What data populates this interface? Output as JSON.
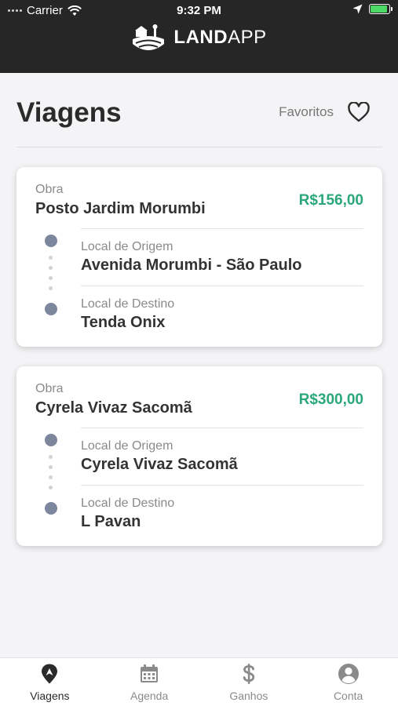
{
  "status_bar": {
    "carrier": "Carrier",
    "time": "9:32 PM"
  },
  "brand": {
    "name_bold": "LAND",
    "name_light": "APP"
  },
  "header": {
    "title": "Viagens",
    "favorites_label": "Favoritos"
  },
  "trips": [
    {
      "obra_label": "Obra",
      "obra_name": "Posto Jardim Morumbi",
      "price": "R$156,00",
      "origin_label": "Local de Origem",
      "origin": "Avenida Morumbi - São Paulo",
      "destination_label": "Local de Destino",
      "destination": "Tenda Onix"
    },
    {
      "obra_label": "Obra",
      "obra_name": "Cyrela Vivaz Sacomã",
      "price": "R$300,00",
      "origin_label": "Local de Origem",
      "origin": "Cyrela Vivaz Sacomã",
      "destination_label": "Local de Destino",
      "destination": "L Pavan"
    }
  ],
  "tabs": [
    {
      "label": "Viagens",
      "icon": "map-pin-icon",
      "active": true
    },
    {
      "label": "Agenda",
      "icon": "calendar-icon",
      "active": false
    },
    {
      "label": "Ganhos",
      "icon": "dollar-icon",
      "active": false
    },
    {
      "label": "Conta",
      "icon": "user-circle-icon",
      "active": false
    }
  ],
  "colors": {
    "price": "#2aa879",
    "topbar": "#262626",
    "route_dot": "#7c879e",
    "battery": "#4cd964"
  }
}
